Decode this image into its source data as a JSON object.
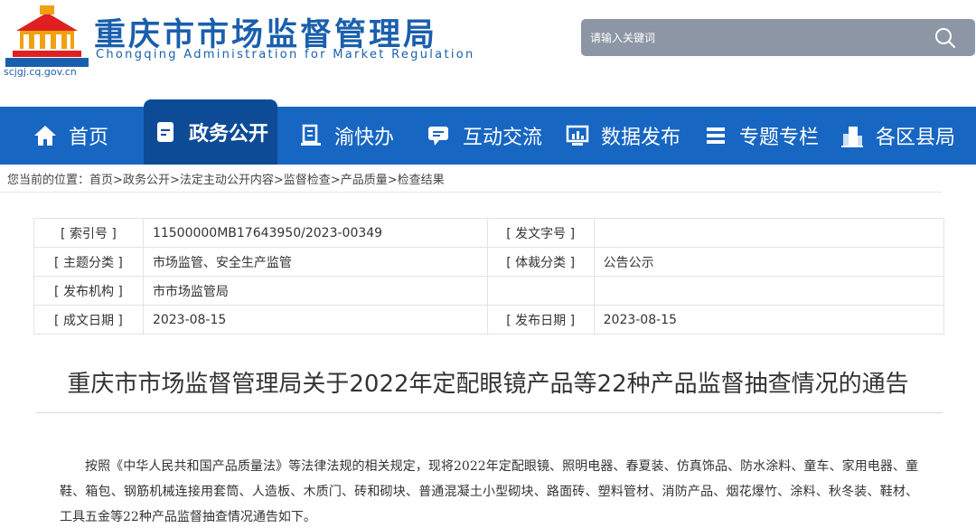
{
  "header": {
    "title": "重庆市市场监督管理局",
    "subtitle": "Chongqing  Administration for Market Regulation",
    "domain": "scjgj.cq.gov.cn",
    "search_placeholder": "请输入关键词",
    "logo_icon": "government-emblem-icon",
    "search_icon": "search-icon"
  },
  "nav": {
    "items": [
      {
        "label": "首页",
        "icon": "home-icon"
      },
      {
        "label": "政务公开",
        "icon": "document-icon",
        "active": true
      },
      {
        "label": "渝快办",
        "icon": "service-icon"
      },
      {
        "label": "互动交流",
        "icon": "chat-icon"
      },
      {
        "label": "数据发布",
        "icon": "chart-icon"
      },
      {
        "label": "专题专栏",
        "icon": "list-icon"
      },
      {
        "label": "各区县局",
        "icon": "building-icon"
      }
    ]
  },
  "breadcrumb": {
    "prefix": "您当前的位置：",
    "items": [
      "首页",
      "政务公开",
      "法定主动公开内容",
      "监督检查",
      "产品质量",
      "检查结果"
    ],
    "separator": ">"
  },
  "meta": {
    "rows": [
      {
        "k1": "[ 索引号 ]",
        "v1": "11500000MB17643950/2023-00349",
        "k2": "[ 发文字号 ]",
        "v2": ""
      },
      {
        "k1": "[ 主题分类 ]",
        "v1": "市场监管、安全生产监管",
        "k2": "[ 体裁分类 ]",
        "v2": "公告公示"
      },
      {
        "k1": "[ 发布机构 ]",
        "v1": "市市场监管局",
        "k2": "",
        "v2": ""
      },
      {
        "k1": "[ 成文日期 ]",
        "v1": "2023-08-15",
        "k2": "[ 发布日期 ]",
        "v2": "2023-08-15"
      }
    ]
  },
  "article": {
    "title": "重庆市市场监督管理局关于2022年定配眼镜产品等22种产品监督抽查情况的通告",
    "body": "按照《中华人民共和国产品质量法》等法律法规的相关规定，现将2022年定配眼镜、照明电器、春夏装、仿真饰品、防水涂料、童车、家用电器、童鞋、箱包、钢筋机械连接用套筒、人造板、木质门、砖和砌块、普通混凝土小型砌块、路面砖、塑料管材、消防产品、烟花爆竹、涂料、秋冬装、鞋材、工具五金等22种产品监督抽查情况通告如下。"
  },
  "colors": {
    "brand_blue": "#1a5fad",
    "nav_blue": "#1766c2",
    "nav_active": "#0d4b97",
    "search_bg": "#8c96a4"
  }
}
